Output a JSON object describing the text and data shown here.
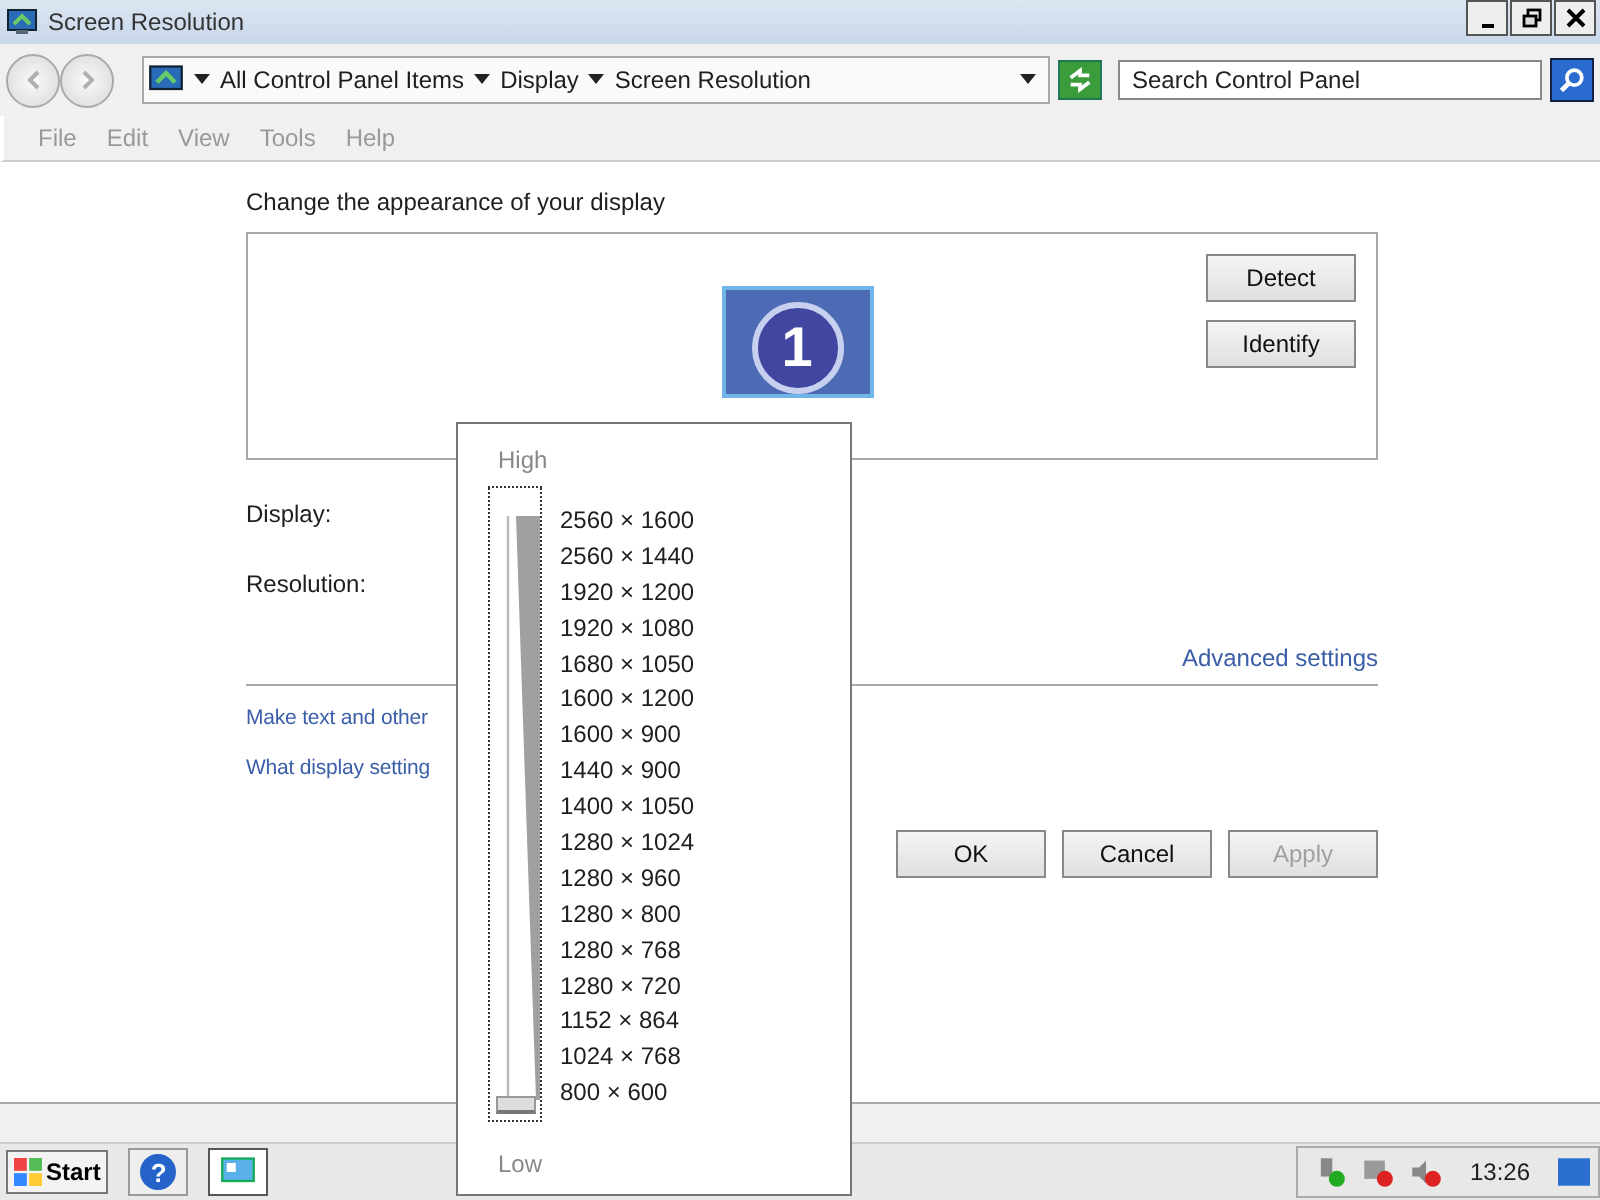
{
  "window": {
    "title": "Screen Resolution"
  },
  "address_bar": {
    "crumbs": [
      "All Control Panel Items",
      "Display",
      "Screen Resolution"
    ]
  },
  "search": {
    "placeholder": "Search Control Panel"
  },
  "menu": [
    "File",
    "Edit",
    "View",
    "Tools",
    "Help"
  ],
  "heading": "Change the appearance of your display",
  "monitor_buttons": [
    "Detect",
    "Identify"
  ],
  "monitor_number": "1",
  "fields": [
    "Display:",
    "Resolution:"
  ],
  "advanced_link": "Advanced settings",
  "links": [
    "Make text and other",
    "What display setting"
  ],
  "buttons": [
    {
      "label": "OK",
      "disabled": false
    },
    {
      "label": "Cancel",
      "disabled": false
    },
    {
      "label": "Apply",
      "disabled": true
    }
  ],
  "resolution_popup": {
    "high_label": "High",
    "low_label": "Low",
    "level": 0,
    "options": [
      "2560 × 1600",
      "2560 × 1440",
      "1920 × 1200",
      "1920 × 1080",
      "1680 × 1050",
      "1600 × 1200",
      "1600 × 900",
      "1440 × 900",
      "1400 × 1050",
      "1280 × 1024",
      "1280 × 960",
      "1280 × 800",
      "1280 × 768",
      "1280 × 720",
      "1152 × 864",
      "1024 × 768",
      "800 × 600"
    ]
  },
  "taskbar": {
    "start": "Start",
    "help_glyph": "?",
    "clock": "13:26"
  }
}
